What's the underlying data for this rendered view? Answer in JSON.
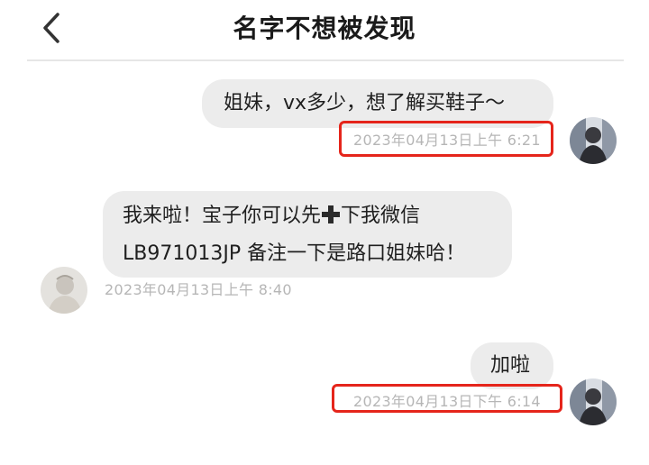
{
  "header": {
    "title": "名字不想被发现"
  },
  "messages": [
    {
      "side": "right",
      "text": "姐妹，vx多少，想了解买鞋子～",
      "timestamp": "2023年04月13日上午 6:21"
    },
    {
      "side": "left",
      "line1_before": "我来啦！宝子你可以先",
      "line1_after": "下我微信",
      "line2": "LB971013JP 备注一下是路口姐妹哈！",
      "timestamp": "2023年04月13日上午 8:40"
    },
    {
      "side": "right",
      "text": "加啦",
      "timestamp": "2023年04月13日下午 6:14"
    }
  ],
  "colors": {
    "bubble": "#ececec",
    "highlight": "#e5251b",
    "timestamp": "#b6b6b6"
  },
  "icons": [
    "chevron-left-icon",
    "plus-icon"
  ]
}
